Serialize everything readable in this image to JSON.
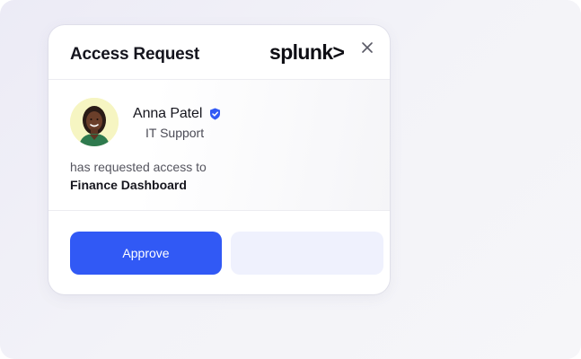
{
  "dialog": {
    "title": "Access Request",
    "brand": "splunk>",
    "close_icon": "close-icon"
  },
  "requester": {
    "name": "Anna Patel",
    "role": "IT Support",
    "verified_icon": "verified-shield-icon"
  },
  "request": {
    "text": "has requested access to",
    "resource": "Finance Dashboard"
  },
  "actions": {
    "approve_label": "Approve",
    "second_label": ""
  },
  "colors": {
    "primary": "#3159f5",
    "secondary_button": "#eff1fd",
    "verified": "#3159f5",
    "avatar_bg": "#f6f5c2"
  }
}
